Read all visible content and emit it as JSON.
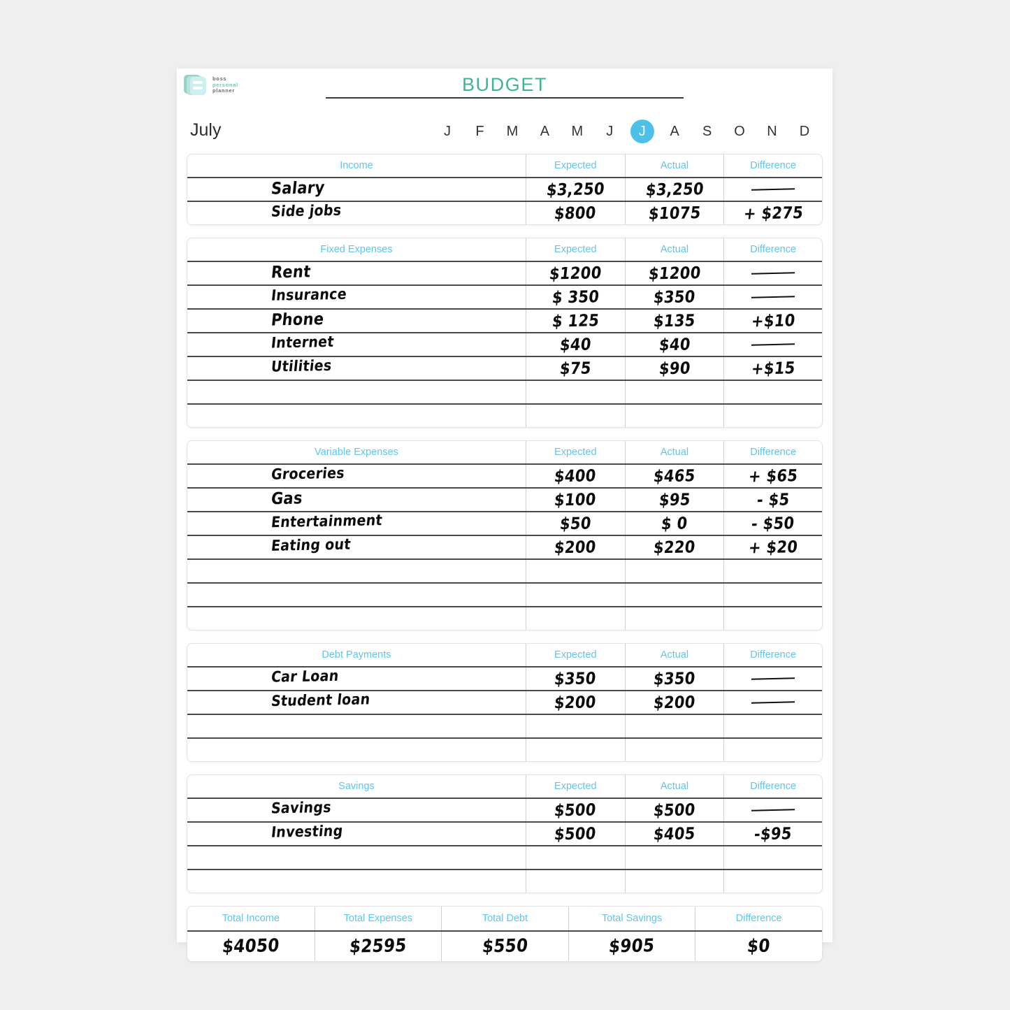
{
  "brand": {
    "line1": "boss",
    "line2": "personal",
    "line3": "planner"
  },
  "header": {
    "title": "BUDGET"
  },
  "month": {
    "name": "July",
    "letters": [
      "J",
      "F",
      "M",
      "A",
      "M",
      "J",
      "J",
      "A",
      "S",
      "O",
      "N",
      "D"
    ],
    "active_index": 6
  },
  "columns": {
    "expected": "Expected",
    "actual": "Actual",
    "difference": "Difference"
  },
  "colors": {
    "title": "#3eb493",
    "header_text": "#5ec5ee",
    "month_active": "#4cc0e8",
    "page_background": "#efefef"
  },
  "sections": [
    {
      "title": "Income",
      "rows": [
        {
          "label": "Salary",
          "expected": "$3,250",
          "actual": "$3,250",
          "difference": "—"
        },
        {
          "label": "Side jobs",
          "expected": "$800",
          "actual": "$1075",
          "difference": "+ $275"
        }
      ]
    },
    {
      "title": "Fixed Expenses",
      "rows": [
        {
          "label": "Rent",
          "expected": "$1200",
          "actual": "$1200",
          "difference": "—"
        },
        {
          "label": "Insurance",
          "expected": "$ 350",
          "actual": "$350",
          "difference": "—"
        },
        {
          "label": "Phone",
          "expected": "$ 125",
          "actual": "$135",
          "difference": "+$10"
        },
        {
          "label": "Internet",
          "expected": "$40",
          "actual": "$40",
          "difference": "—"
        },
        {
          "label": "Utilities",
          "expected": "$75",
          "actual": "$90",
          "difference": "+$15"
        },
        {
          "label": "",
          "expected": "",
          "actual": "",
          "difference": ""
        },
        {
          "label": "",
          "expected": "",
          "actual": "",
          "difference": ""
        }
      ]
    },
    {
      "title": "Variable Expenses",
      "rows": [
        {
          "label": "Groceries",
          "expected": "$400",
          "actual": "$465",
          "difference": "+ $65"
        },
        {
          "label": "Gas",
          "expected": "$100",
          "actual": "$95",
          "difference": "- $5"
        },
        {
          "label": "Entertainment",
          "expected": "$50",
          "actual": "$ 0",
          "difference": "- $50"
        },
        {
          "label": "Eating out",
          "expected": "$200",
          "actual": "$220",
          "difference": "+ $20"
        },
        {
          "label": "",
          "expected": "",
          "actual": "",
          "difference": ""
        },
        {
          "label": "",
          "expected": "",
          "actual": "",
          "difference": ""
        },
        {
          "label": "",
          "expected": "",
          "actual": "",
          "difference": ""
        }
      ]
    },
    {
      "title": "Debt Payments",
      "rows": [
        {
          "label": "Car Loan",
          "expected": "$350",
          "actual": "$350",
          "difference": "—"
        },
        {
          "label": "Student loan",
          "expected": "$200",
          "actual": "$200",
          "difference": "—"
        },
        {
          "label": "",
          "expected": "",
          "actual": "",
          "difference": ""
        },
        {
          "label": "",
          "expected": "",
          "actual": "",
          "difference": ""
        }
      ]
    },
    {
      "title": "Savings",
      "rows": [
        {
          "label": "Savings",
          "expected": "$500",
          "actual": "$500",
          "difference": "—"
        },
        {
          "label": "Investing",
          "expected": "$500",
          "actual": "$405",
          "difference": "-$95"
        },
        {
          "label": "",
          "expected": "",
          "actual": "",
          "difference": ""
        },
        {
          "label": "",
          "expected": "",
          "actual": "",
          "difference": ""
        }
      ]
    }
  ],
  "totals": {
    "headers": [
      "Total Income",
      "Total Expenses",
      "Total Debt",
      "Total Savings",
      "Difference"
    ],
    "values": [
      "$4050",
      "$2595",
      "$550",
      "$905",
      "$0"
    ]
  }
}
